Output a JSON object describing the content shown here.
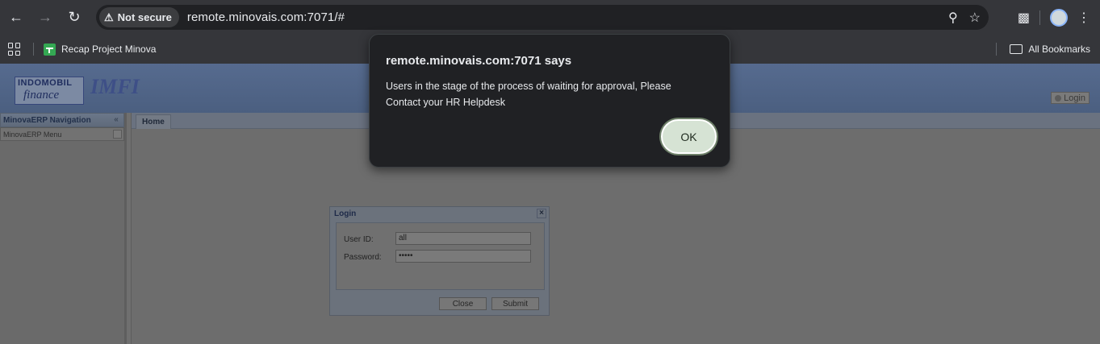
{
  "browser": {
    "security_chip": "Not secure",
    "url": "remote.minovais.com:7071/#",
    "bookmarks": [
      {
        "label": "Recap Project Minova",
        "icon": "sheets-icon"
      }
    ],
    "all_bookmarks": "All Bookmarks"
  },
  "app": {
    "logo_primary_line1": "INDOMOBIL",
    "logo_primary_line2": "finance",
    "logo_secondary": "IMFI",
    "login_button": "Login",
    "nav_panel_title": "MinovaERP Navigation",
    "nav_menu": "MinovaERP Menu",
    "tabs": [
      {
        "label": "Home"
      }
    ],
    "login_window": {
      "title": "Login",
      "user_id_label": "User ID:",
      "user_id_value": "all",
      "password_label": "Password:",
      "password_value": "•••••",
      "close_button": "Close",
      "submit_button": "Submit"
    }
  },
  "alert": {
    "title": "remote.minovais.com:7071 says",
    "message": "Users in the stage of the process of waiting for approval, Please Contact your HR Helpdesk",
    "ok_button": "OK"
  }
}
